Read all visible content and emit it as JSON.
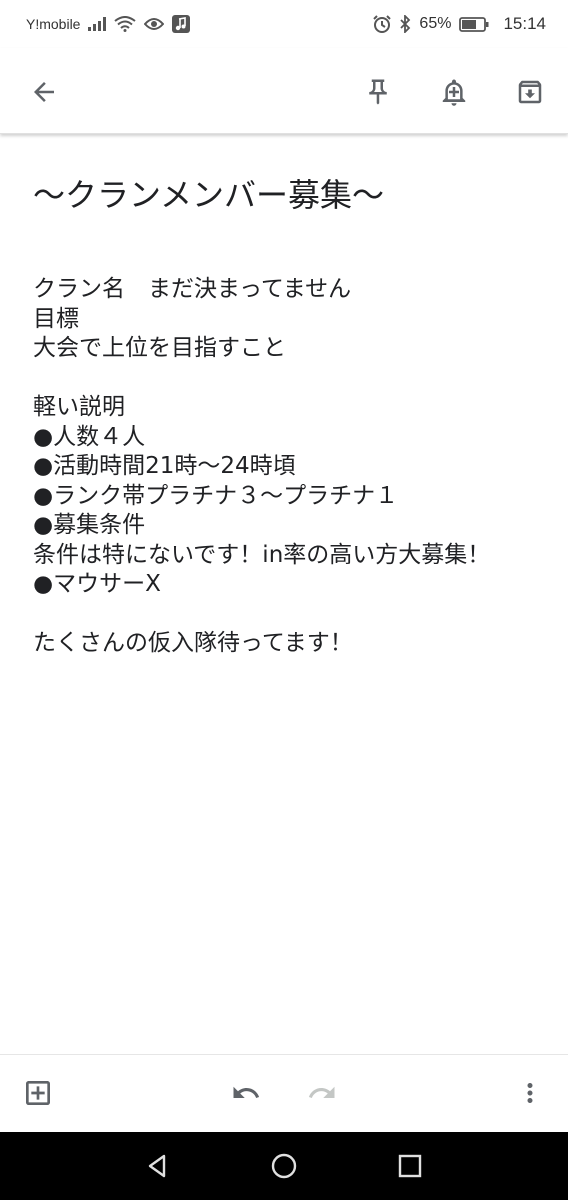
{
  "status_bar": {
    "carrier": "Y!mobile",
    "battery": "65%",
    "time": "15:14"
  },
  "note": {
    "title": "～クランメンバー募集～",
    "lines": [
      "クラン名　まだ決まってません",
      "目標",
      "大会で上位を目指すこと",
      "",
      "軽い説明",
      "●人数４人",
      "●活動時間21時～24時頃",
      "●ランク帯プラチナ３～プラチナ１",
      "●募集条件",
      "条件は特にないです！in率の高い方大募集！",
      "●マウサーX",
      "",
      "たくさんの仮入隊待ってます！"
    ]
  },
  "icons": {
    "back": "arrow-back-icon",
    "pin": "pin-icon",
    "reminder": "add-alert-icon",
    "archive": "archive-icon",
    "add": "add-box-icon",
    "undo": "undo-icon",
    "redo": "redo-icon",
    "more": "more-vert-icon"
  },
  "colors": {
    "icon": "#5f6368",
    "icon_disabled": "#c4c7c5",
    "nav_bar": "#000000"
  }
}
